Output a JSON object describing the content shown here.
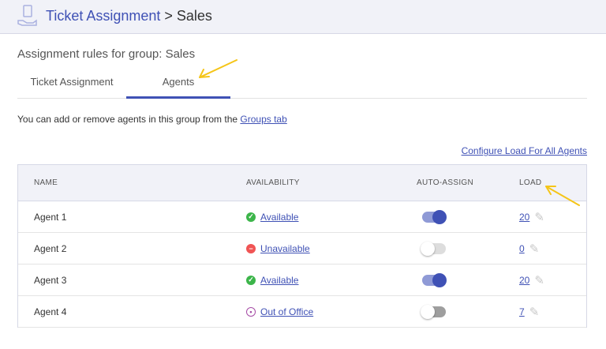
{
  "header": {
    "breadcrumb_link": "Ticket Assignment",
    "breadcrumb_sep": " > ",
    "breadcrumb_current": "Sales",
    "icon": "ticket-hand-icon"
  },
  "subtitle": "Assignment rules for group: Sales",
  "tabs": [
    {
      "label": "Ticket Assignment",
      "active": false
    },
    {
      "label": "Agents",
      "active": true
    }
  ],
  "info": {
    "text": "You can add or remove agents in this group from the ",
    "link": "Groups tab"
  },
  "configure_link": "Configure Load For All Agents",
  "table": {
    "columns": [
      "NAME",
      "AVAILABILITY",
      "AUTO-ASSIGN",
      "LOAD"
    ],
    "rows": [
      {
        "name": "Agent 1",
        "availability": "Available",
        "status_icon": "check-circle-icon",
        "auto_assign": true,
        "load": "20"
      },
      {
        "name": "Agent 2",
        "availability": "Unavailable",
        "status_icon": "minus-circle-icon",
        "auto_assign": false,
        "load": "0"
      },
      {
        "name": "Agent 3",
        "availability": "Available",
        "status_icon": "check-circle-icon",
        "auto_assign": true,
        "load": "20"
      },
      {
        "name": "Agent 4",
        "availability": "Out of Office",
        "status_icon": "out-of-office-icon",
        "auto_assign": false,
        "load": "7"
      }
    ]
  },
  "colors": {
    "accent": "#3f51b5",
    "available": "#3cb54a",
    "unavailable": "#f05454",
    "out_of_office": "#a64ca6",
    "annotation": "#f5c518"
  }
}
